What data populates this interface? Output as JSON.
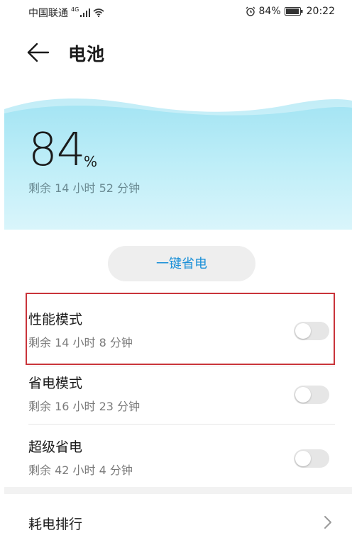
{
  "status_bar": {
    "carrier": "中国联通",
    "network": "4G",
    "battery_percent": "84%",
    "time": "20:22",
    "icons": [
      "signal-icon",
      "wifi-icon",
      "alarm-icon",
      "battery-icon"
    ]
  },
  "header": {
    "title": "电池",
    "back_icon": "arrow-left-icon"
  },
  "battery": {
    "level": "84",
    "unit": "%",
    "remaining": "剩余 14 小时 52 分钟",
    "level_fraction": 0.84
  },
  "save_button": {
    "label": "一键省电"
  },
  "modes": [
    {
      "title": "性能模式",
      "remaining": "剩余 14 小时 8 分钟",
      "enabled": false
    },
    {
      "title": "省电模式",
      "remaining": "剩余 16 小时 23 分钟",
      "enabled": false
    },
    {
      "title": "超级省电",
      "remaining": "剩余 42 小时 4 分钟",
      "enabled": false
    }
  ],
  "ranking": {
    "label": "耗电排行"
  },
  "colors": {
    "accent": "#1a90d8",
    "highlight_border": "#c9343a",
    "hero_top": "#9ee2f2",
    "hero_bottom": "#d9f5fb",
    "toggle_off": "#e6e6e6"
  }
}
